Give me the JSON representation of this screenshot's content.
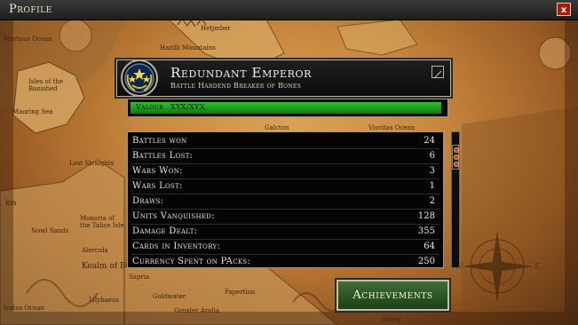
{
  "window": {
    "title": "Profile",
    "close_label": "x"
  },
  "map_labels": [
    "Mortuus Ocean",
    "Hetjmber",
    "Hazilli Mountains",
    "Isles of the Banished",
    "Maoring Sea",
    "Lost Straights",
    "Nowl Sands",
    "Alercula",
    "Kealm of Bucannse",
    "Lilybaeus",
    "Iratus Ocean",
    "Galcton",
    "Visvitas Ocean",
    "Greater Aralia",
    "Papertion",
    "Asteel",
    "Monoria of the Talice Isle",
    "Sapria",
    "Goldwater",
    "km"
  ],
  "header": {
    "player_name": "Redundant Emperor",
    "player_title": "Battle Hardend Breaker of Bones"
  },
  "valour": {
    "label": "Valour",
    "value": "XYX/XYX",
    "fill_fraction": 0.99
  },
  "stats": [
    {
      "label": "Battles won",
      "value": "24"
    },
    {
      "label": "Battles Lost:",
      "value": "6"
    },
    {
      "label": "Wars Won:",
      "value": "3"
    },
    {
      "label": "Wars Lost:",
      "value": "1"
    },
    {
      "label": "Draws:",
      "value": "2"
    },
    {
      "label": "Units Vanquished:",
      "value": "128"
    },
    {
      "label": "Damage Dealt:",
      "value": "355"
    },
    {
      "label": "Cards in Inventory:",
      "value": "64"
    },
    {
      "label": "Currency Spent on PAcks:",
      "value": "250"
    }
  ],
  "achievements": {
    "label": "Achievements"
  },
  "icons": {
    "emblem": "rank-wreath-stars-icon",
    "edit": "edit-pencil-icon",
    "close": "close-icon",
    "compass": "compass-rose-icon"
  },
  "colors": {
    "valour_fill": "#22a022",
    "close_button": "#a51c12",
    "achievements_button": "#2f5a28"
  }
}
